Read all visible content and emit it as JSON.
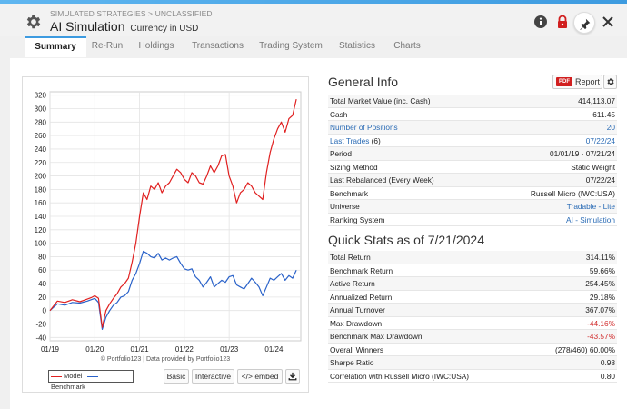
{
  "header": {
    "breadcrumb": "SIMULATED STRATEGIES > UNCLASSIFIED",
    "title": "AI Simulation",
    "currency": "Currency in USD",
    "icons": [
      "gear-icon",
      "info-icon",
      "lock-icon",
      "pin-icon",
      "close-icon"
    ]
  },
  "tabs": [
    "Summary",
    "Re-Run",
    "Holdings",
    "Transactions",
    "Trading System",
    "Statistics",
    "Charts"
  ],
  "active_tab": "Summary",
  "chart": {
    "copyright": "© Portfolio123 | Data provided by Portfolio123",
    "legend": [
      "Model",
      "Benchmark"
    ],
    "buttons": {
      "basic": "Basic",
      "interactive": "Interactive",
      "embed": "</> embed",
      "download_icon": "download-icon"
    }
  },
  "chart_data": {
    "type": "line",
    "x_ticks": [
      "01/19",
      "01/20",
      "01/21",
      "01/22",
      "01/23",
      "01/24"
    ],
    "y_ticks": [
      -40,
      -20,
      0,
      20,
      40,
      60,
      80,
      100,
      120,
      140,
      160,
      180,
      200,
      220,
      240,
      260,
      280,
      300,
      320
    ],
    "ylim": [
      -45,
      325
    ],
    "grid": true,
    "series": [
      {
        "name": "Model",
        "color": "#e02020",
        "points": [
          [
            "01/19",
            0
          ],
          [
            "03/19",
            14
          ],
          [
            "05/19",
            12
          ],
          [
            "07/19",
            16
          ],
          [
            "09/19",
            13
          ],
          [
            "11/19",
            17
          ],
          [
            "12/19",
            19
          ],
          [
            "01/20",
            22
          ],
          [
            "02/20",
            18
          ],
          [
            "03/20",
            -25
          ],
          [
            "04/20",
            0
          ],
          [
            "05/20",
            10
          ],
          [
            "06/20",
            18
          ],
          [
            "07/20",
            25
          ],
          [
            "08/20",
            35
          ],
          [
            "09/20",
            40
          ],
          [
            "10/20",
            48
          ],
          [
            "11/20",
            72
          ],
          [
            "12/20",
            100
          ],
          [
            "01/21",
            140
          ],
          [
            "02/21",
            175
          ],
          [
            "03/21",
            165
          ],
          [
            "04/21",
            185
          ],
          [
            "05/21",
            180
          ],
          [
            "06/21",
            190
          ],
          [
            "07/21",
            175
          ],
          [
            "08/21",
            185
          ],
          [
            "09/21",
            190
          ],
          [
            "10/21",
            200
          ],
          [
            "11/21",
            210
          ],
          [
            "12/21",
            205
          ],
          [
            "01/22",
            195
          ],
          [
            "02/22",
            190
          ],
          [
            "03/22",
            205
          ],
          [
            "04/22",
            200
          ],
          [
            "05/22",
            190
          ],
          [
            "06/22",
            188
          ],
          [
            "07/22",
            200
          ],
          [
            "08/22",
            215
          ],
          [
            "09/22",
            205
          ],
          [
            "10/22",
            215
          ],
          [
            "11/22",
            230
          ],
          [
            "12/22",
            232
          ],
          [
            "01/23",
            200
          ],
          [
            "02/23",
            185
          ],
          [
            "03/23",
            160
          ],
          [
            "04/23",
            175
          ],
          [
            "05/23",
            180
          ],
          [
            "06/23",
            190
          ],
          [
            "07/23",
            185
          ],
          [
            "08/23",
            175
          ],
          [
            "09/23",
            170
          ],
          [
            "10/23",
            165
          ],
          [
            "11/23",
            205
          ],
          [
            "12/23",
            235
          ],
          [
            "01/24",
            255
          ],
          [
            "02/24",
            270
          ],
          [
            "03/24",
            280
          ],
          [
            "04/24",
            265
          ],
          [
            "05/24",
            285
          ],
          [
            "06/24",
            290
          ],
          [
            "07/24",
            314
          ]
        ]
      },
      {
        "name": "Benchmark",
        "color": "#2a62c9",
        "points": [
          [
            "01/19",
            0
          ],
          [
            "03/19",
            10
          ],
          [
            "05/19",
            8
          ],
          [
            "07/19",
            12
          ],
          [
            "09/19",
            11
          ],
          [
            "11/19",
            14
          ],
          [
            "12/19",
            16
          ],
          [
            "01/20",
            18
          ],
          [
            "02/20",
            12
          ],
          [
            "03/20",
            -28
          ],
          [
            "04/20",
            -10
          ],
          [
            "05/20",
            0
          ],
          [
            "06/20",
            8
          ],
          [
            "07/20",
            12
          ],
          [
            "08/20",
            20
          ],
          [
            "09/20",
            22
          ],
          [
            "10/20",
            28
          ],
          [
            "11/20",
            45
          ],
          [
            "12/20",
            55
          ],
          [
            "01/21",
            70
          ],
          [
            "02/21",
            88
          ],
          [
            "03/21",
            85
          ],
          [
            "04/21",
            80
          ],
          [
            "05/21",
            78
          ],
          [
            "06/21",
            85
          ],
          [
            "07/21",
            75
          ],
          [
            "08/21",
            78
          ],
          [
            "09/21",
            75
          ],
          [
            "10/21",
            78
          ],
          [
            "11/21",
            80
          ],
          [
            "12/21",
            70
          ],
          [
            "01/22",
            62
          ],
          [
            "02/22",
            60
          ],
          [
            "03/22",
            62
          ],
          [
            "04/22",
            50
          ],
          [
            "05/22",
            45
          ],
          [
            "06/22",
            35
          ],
          [
            "07/22",
            42
          ],
          [
            "08/22",
            50
          ],
          [
            "09/22",
            35
          ],
          [
            "10/22",
            40
          ],
          [
            "11/22",
            45
          ],
          [
            "12/22",
            42
          ],
          [
            "01/23",
            50
          ],
          [
            "02/23",
            52
          ],
          [
            "03/23",
            38
          ],
          [
            "04/23",
            35
          ],
          [
            "05/23",
            32
          ],
          [
            "06/23",
            40
          ],
          [
            "07/23",
            48
          ],
          [
            "08/23",
            42
          ],
          [
            "09/23",
            35
          ],
          [
            "10/23",
            22
          ],
          [
            "11/23",
            35
          ],
          [
            "12/23",
            48
          ],
          [
            "01/24",
            45
          ],
          [
            "02/24",
            50
          ],
          [
            "03/24",
            55
          ],
          [
            "04/24",
            45
          ],
          [
            "05/24",
            52
          ],
          [
            "06/24",
            48
          ],
          [
            "07/24",
            60
          ]
        ]
      }
    ]
  },
  "general_info": {
    "title": "General Info",
    "report_label": "Report",
    "pdf_badge": "PDF",
    "rows": [
      {
        "k": "Total Market Value (inc. Cash)",
        "v": "414,113.07"
      },
      {
        "k": "Cash",
        "v": "611.45"
      },
      {
        "k": "Number of Positions",
        "v": "20",
        "klink": true,
        "vlink": true
      },
      {
        "k": "Last Trades",
        "kextra": " (6)",
        "v": "07/22/24",
        "klink": true,
        "vlink": true
      },
      {
        "k": "Period",
        "v": "01/01/19 - 07/21/24"
      },
      {
        "k": "Sizing Method",
        "v": "Static Weight"
      },
      {
        "k": "Last Rebalanced (Every Week)",
        "v": "07/22/24"
      },
      {
        "k": "Benchmark",
        "v": "Russell Micro (IWC:USA)"
      },
      {
        "k": "Universe",
        "v": "Tradable - Lite",
        "vlink": true
      },
      {
        "k": "Ranking System",
        "v": "AI - Simulation",
        "vlink": true
      }
    ]
  },
  "quick_stats": {
    "title": "Quick Stats as of 7/21/2024",
    "rows": [
      {
        "k": "Total Return",
        "v": "314.11%"
      },
      {
        "k": "Benchmark Return",
        "v": "59.66%"
      },
      {
        "k": "Active Return",
        "v": "254.45%"
      },
      {
        "k": "Annualized Return",
        "v": "29.18%"
      },
      {
        "k": "Annual Turnover",
        "v": "367.07%"
      },
      {
        "k": "Max Drawdown",
        "v": "-44.16%",
        "neg": true
      },
      {
        "k": "Benchmark Max Drawdown",
        "v": "-43.57%",
        "neg": true
      },
      {
        "k": "Overall Winners",
        "v": "(278/460) 60.00%"
      },
      {
        "k": "Sharpe Ratio",
        "v": "0.98"
      },
      {
        "k": "Correlation with Russell Micro (IWC:USA)",
        "v": "0.80"
      }
    ]
  }
}
